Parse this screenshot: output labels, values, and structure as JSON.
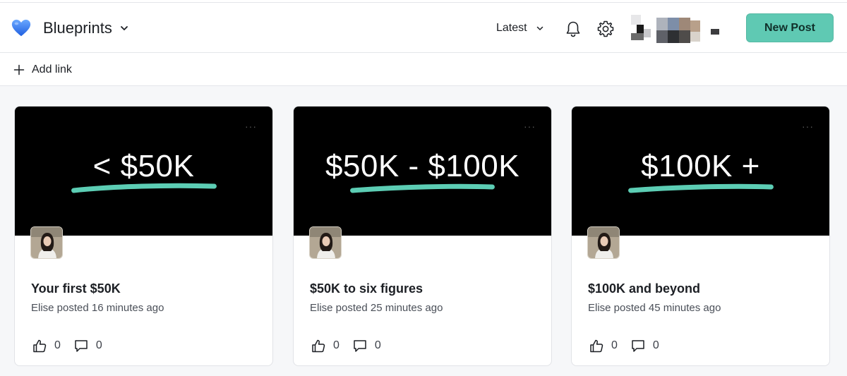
{
  "header": {
    "space_title": "Blueprints",
    "sort_label": "Latest",
    "new_post_label": "New Post",
    "icons": {
      "space": "blue-heart-icon",
      "space_menu": "chevron-down-icon",
      "sort_menu": "chevron-down-icon",
      "notifications": "bell-icon",
      "settings": "gear-icon"
    },
    "colors": {
      "accent": "#5fc9b3",
      "heart": "#3b82f6"
    }
  },
  "linkbar": {
    "add_link_label": "Add link",
    "icon": "plus-icon"
  },
  "posts": [
    {
      "cover_text": "< $50K",
      "title": "Your first $50K",
      "meta": "Elise posted 16 minutes ago",
      "likes": "0",
      "comments": "0"
    },
    {
      "cover_text": "$50K - $100K",
      "title": "$50K to six figures",
      "meta": "Elise posted 25 minutes ago",
      "likes": "0",
      "comments": "0"
    },
    {
      "cover_text": "$100K +",
      "title": "$100K and beyond",
      "meta": "Elise posted 45 minutes ago",
      "likes": "0",
      "comments": "0"
    }
  ],
  "card_more_label": "···",
  "swoosh_color": "#5ccdb4"
}
